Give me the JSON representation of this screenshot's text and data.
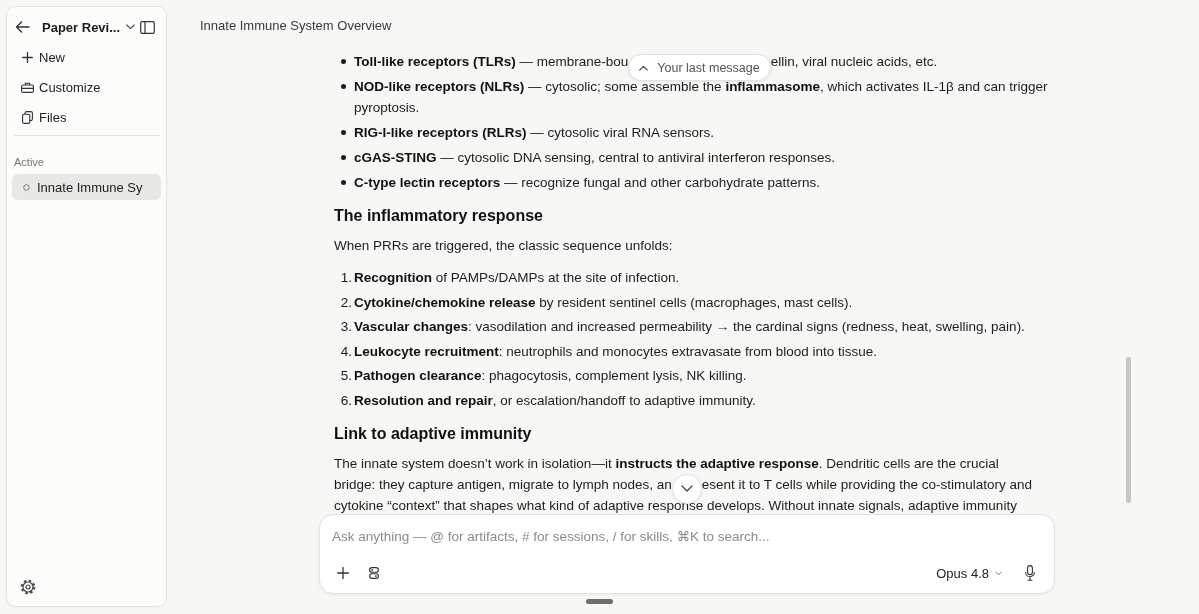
{
  "sidebar": {
    "project": "Paper Revi...",
    "nav": [
      {
        "kind": "new",
        "label": "New"
      },
      {
        "kind": "customize",
        "label": "Customize"
      },
      {
        "kind": "files",
        "label": "Files"
      }
    ],
    "section": "Active",
    "sessions": [
      {
        "title": "Innate Immune Sy",
        "selected": true
      }
    ]
  },
  "header": {
    "title": "Innate Immune System Overview"
  },
  "content": [
    {
      "kind": "bullets",
      "items": [
        {
          "segments": [
            "**Toll-like receptors (TLRs)** — membrane-bou",
            {
              "kind": "jump_button",
              "label": "Your last message"
            },
            "ellin, viral nucleic acids, etc."
          ]
        },
        {
          "segments": [
            "**NOD-like receptors (NLRs)** — cytosolic; some assemble the **inflammasome**, which activates IL-1β and can trigger pyroptosis."
          ]
        },
        {
          "segments": [
            "**RIG-I-like receptors (RLRs)** — cytosolic viral RNA sensors."
          ]
        },
        {
          "segments": [
            "**cGAS-STING** — cytosolic DNA sensing, central to antiviral interferon responses."
          ]
        },
        {
          "segments": [
            "**C-type lectin receptors** — recognize fungal and other carbohydrate patterns."
          ]
        }
      ]
    },
    {
      "kind": "heading",
      "text": "The inflammatory response"
    },
    {
      "kind": "paragraph",
      "text": "When PRRs are triggered, the classic sequence unfolds:"
    },
    {
      "kind": "numbered",
      "items": [
        {
          "number": "1.",
          "segments": [
            "**Recognition** of PAMPs/DAMPs at the site of infection."
          ]
        },
        {
          "number": "2.",
          "segments": [
            "**Cytokine/chemokine release** by resident sentinel cells (macrophages, mast cells)."
          ]
        },
        {
          "number": "3.",
          "segments": [
            "**Vascular changes**: vasodilation and increased permeability → the cardinal signs (redness, heat, swelling, pain)."
          ]
        },
        {
          "number": "4.",
          "segments": [
            "**Leukocyte recruitment**: neutrophils and monocytes extravasate from blood into tissue."
          ]
        },
        {
          "number": "5.",
          "segments": [
            "**Pathogen clearance**: phagocytosis, complement lysis, NK killing."
          ]
        },
        {
          "number": "6.",
          "segments": [
            "**Resolution and repair**, or escalation/handoff to adaptive immunity."
          ]
        }
      ]
    },
    {
      "kind": "heading",
      "text": "Link to adaptive immunity"
    },
    {
      "kind": "paragraph",
      "lines": [
        {
          "segments": [
            "The innate system doesn’t work in isolation—it **instructs the adaptive response**. Dendritic cells are the crucial"
          ]
        },
        {
          "segments": [
            "bridge: they capture antigen, migrate to lymph nodes, an",
            {
              "kind": "scroll_down"
            },
            "esent it to T cells while providing the co-stimulatory and"
          ]
        },
        {
          "segments": [
            "cytokine “context” that shapes what kind of adaptive response develops. Without innate signals, adaptive immunity"
          ]
        }
      ]
    }
  ],
  "composer": {
    "placeholder": "Ask anything — @ for artifacts, # for sessions, / for skills, ⌘K to search...",
    "model": "Opus 4.8"
  }
}
